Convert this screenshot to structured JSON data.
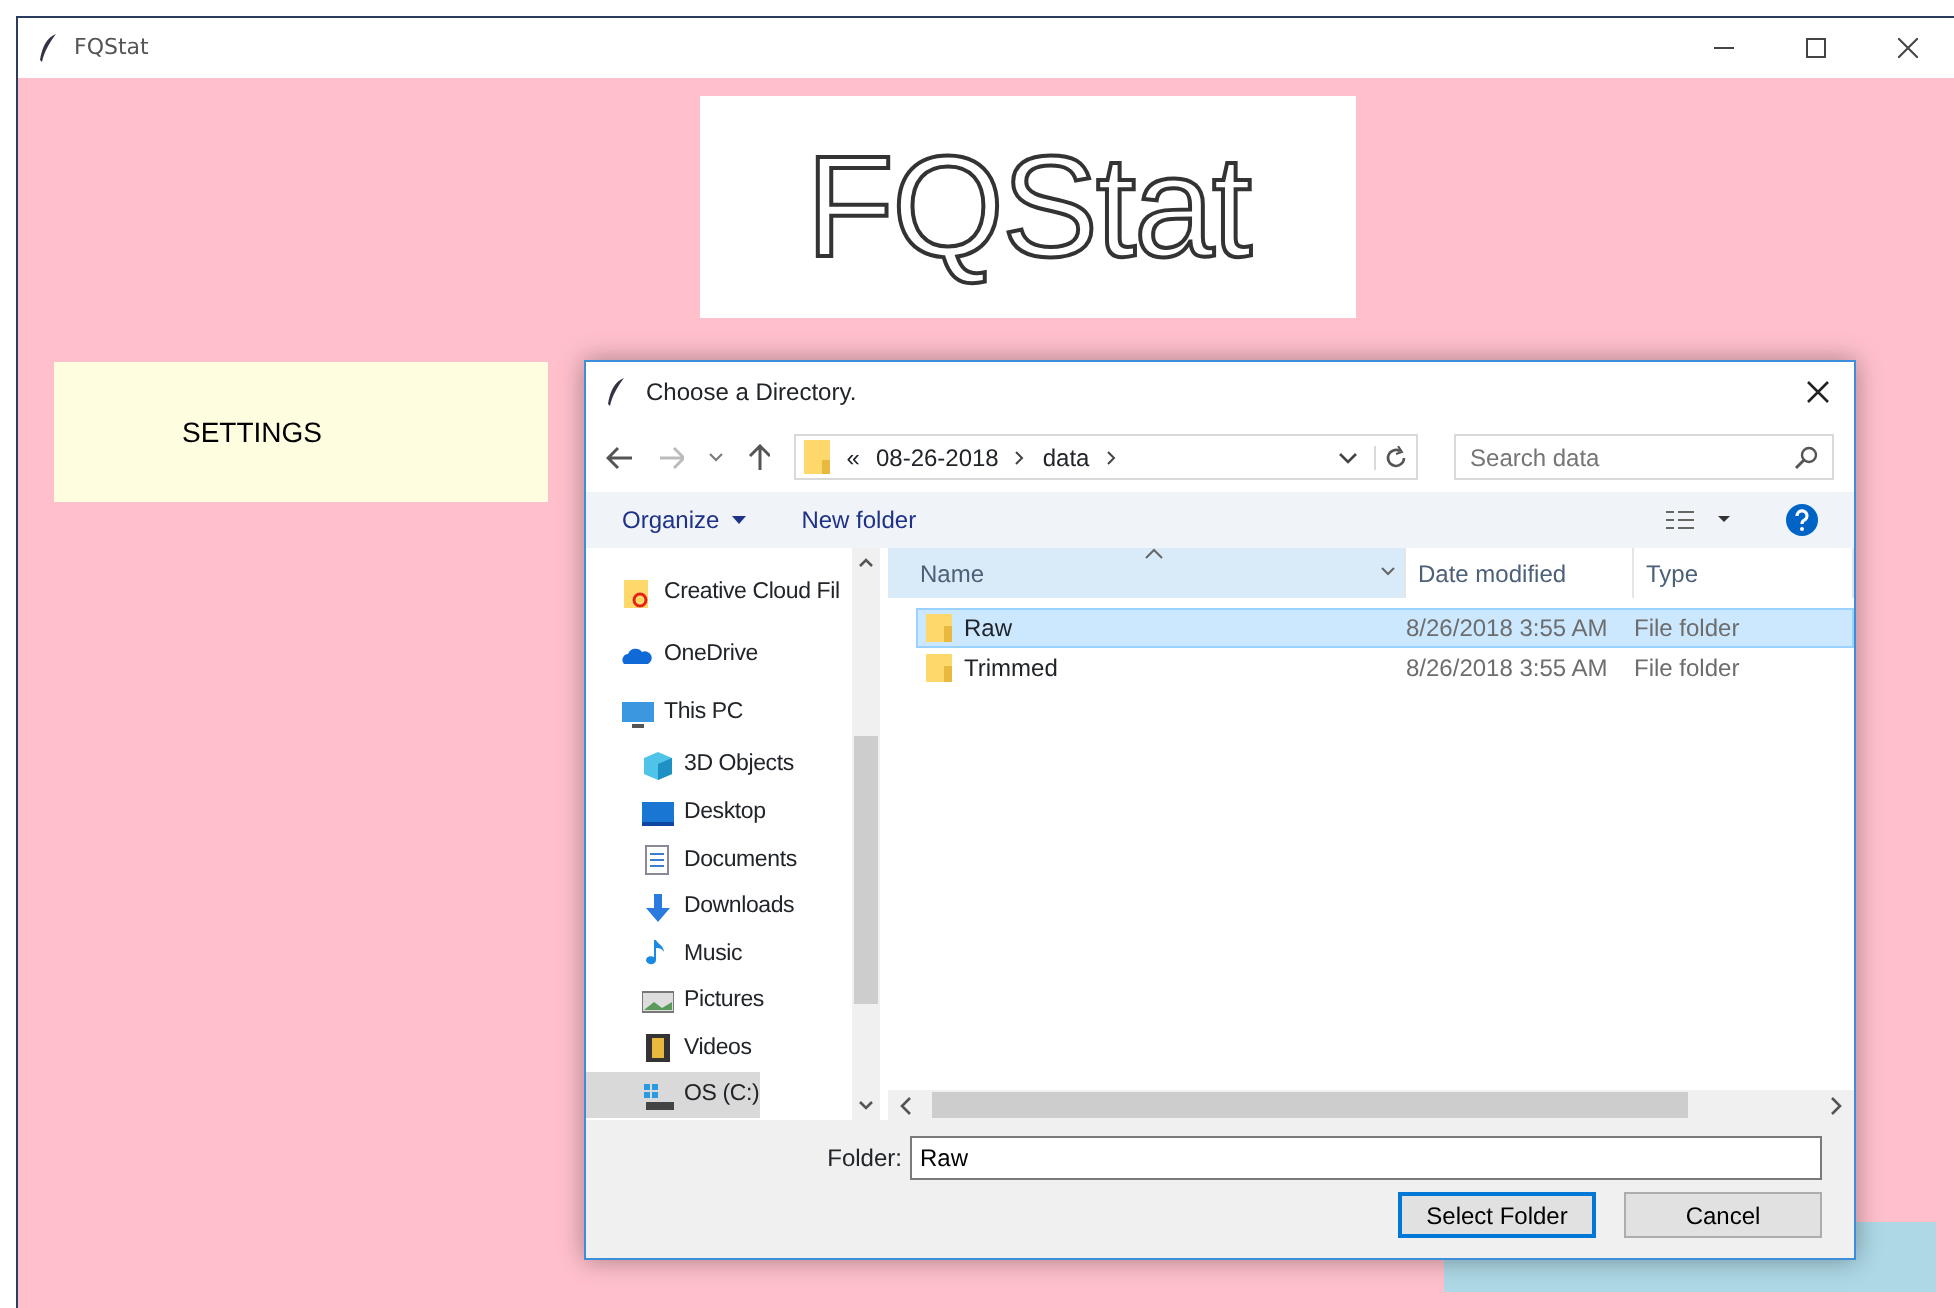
{
  "window": {
    "title": "FQStat"
  },
  "app": {
    "logo": "FQStat",
    "settings_button": "SETTINGS"
  },
  "dialog": {
    "title": "Choose a Directory.",
    "path_overflow": "«",
    "path": [
      "08-26-2018",
      "data"
    ],
    "search": {
      "placeholder": "Search data"
    },
    "toolbar": [
      {
        "label": "Organize",
        "dropdown": true
      },
      {
        "label": "New folder",
        "dropdown": false
      }
    ],
    "nav_items": [
      {
        "label": "Creative Cloud Fil",
        "selected": false
      },
      {
        "label": "OneDrive",
        "selected": false
      },
      {
        "label": "This PC",
        "selected": false,
        "children": [
          {
            "label": "3D Objects",
            "selected": false
          },
          {
            "label": "Desktop",
            "selected": false
          },
          {
            "label": "Documents",
            "selected": false
          },
          {
            "label": "Downloads",
            "selected": false
          },
          {
            "label": "Music",
            "selected": false
          },
          {
            "label": "Pictures",
            "selected": false
          },
          {
            "label": "Videos",
            "selected": false
          },
          {
            "label": "OS (C:)",
            "selected": true
          }
        ]
      }
    ],
    "columns": [
      "Name",
      "Date modified",
      "Type"
    ],
    "rows": [
      {
        "name": "Raw",
        "date": "8/26/2018 3:55 AM",
        "type": "File folder",
        "selected": true
      },
      {
        "name": "Trimmed",
        "date": "8/26/2018 3:55 AM",
        "type": "File folder",
        "selected": false
      }
    ],
    "folder_label": "Folder:",
    "folder_value": "Raw",
    "buttons": [
      {
        "label": "Select Folder",
        "kind": "primary"
      },
      {
        "label": "Cancel",
        "kind": "secondary"
      }
    ]
  }
}
